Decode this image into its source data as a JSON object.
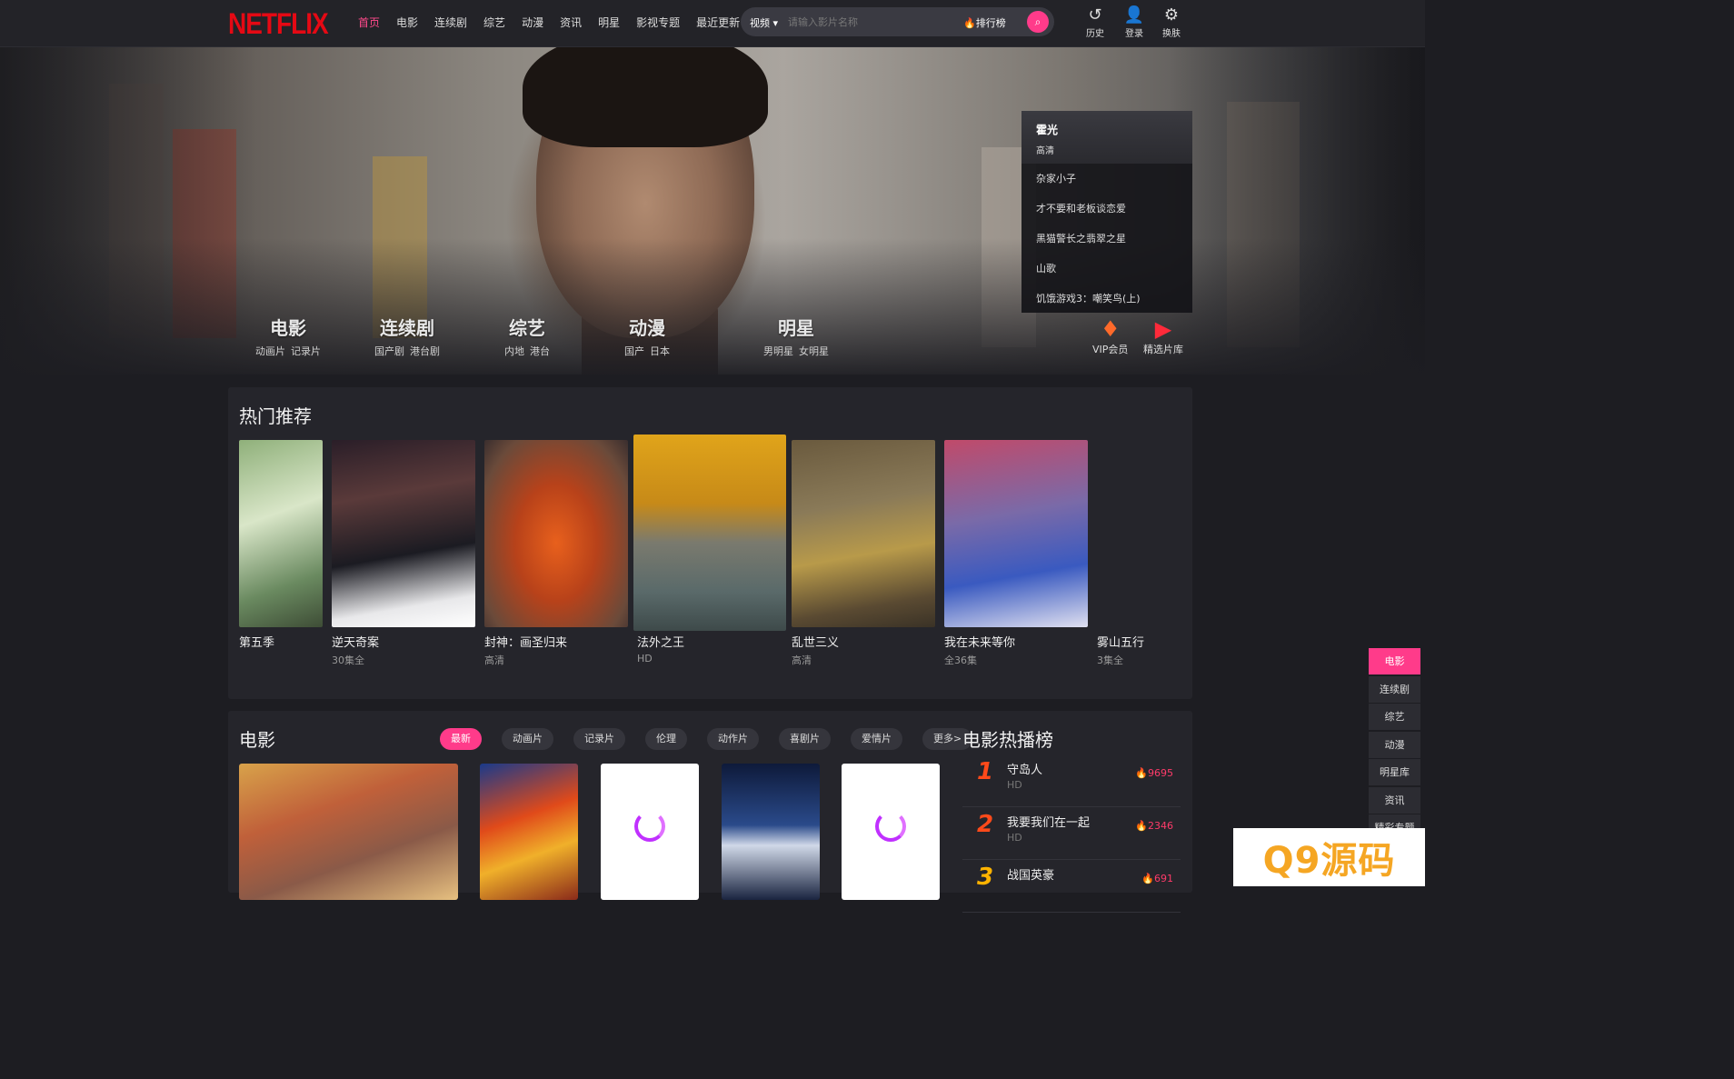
{
  "header": {
    "logo": "NETFLIX",
    "nav": [
      "首页",
      "电影",
      "连续剧",
      "综艺",
      "动漫",
      "资讯",
      "明星",
      "影视专题",
      "最近更新"
    ],
    "active_nav": "首页",
    "search": {
      "category": "视频 ▾",
      "placeholder": "请输入影片名称",
      "rank_label": "排行榜"
    },
    "icons": [
      {
        "label": "历史",
        "icon": "history-icon"
      },
      {
        "label": "登录",
        "icon": "user-icon"
      },
      {
        "label": "换肤",
        "icon": "gear-icon"
      }
    ]
  },
  "banner": {
    "categories": [
      {
        "title": "电影",
        "subs": [
          "动画片",
          "记录片"
        ]
      },
      {
        "title": "连续剧",
        "subs": [
          "国产剧",
          "港台剧"
        ]
      },
      {
        "title": "综艺",
        "subs": [
          "内地",
          "港台"
        ]
      },
      {
        "title": "动漫",
        "subs": [
          "国产",
          "日本"
        ]
      },
      {
        "title": "明星",
        "subs": [
          "男明星",
          "女明星"
        ]
      }
    ],
    "side_list": {
      "current_title": "霍光",
      "current_quality": "高清",
      "items": [
        "杂家小子",
        "才不要和老板谈恋爱",
        "黑猫警长之翡翠之星",
        "山歌",
        "饥饿游戏3：嘲笑鸟(上)"
      ]
    },
    "buttons": [
      {
        "label": "VIP会员",
        "icon": "diamond-icon"
      },
      {
        "label": "精选片库",
        "icon": "play-icon"
      }
    ]
  },
  "hot": {
    "title": "热门推荐",
    "items": [
      {
        "name": "第五季",
        "note": ""
      },
      {
        "name": "逆天奇案",
        "note": "30集全"
      },
      {
        "name": "封神：画圣归来",
        "note": "高清"
      },
      {
        "name": "法外之王",
        "note": "HD"
      },
      {
        "name": "乱世三义",
        "note": "高清"
      },
      {
        "name": "我在未来等你",
        "note": "全36集"
      },
      {
        "name": "雾山五行",
        "note": "3集全"
      }
    ]
  },
  "movie": {
    "title": "电影",
    "tags": [
      "最新",
      "动画片",
      "记录片",
      "伦理",
      "动作片",
      "喜剧片",
      "爱情片",
      "更多>"
    ],
    "active_tag": "最新",
    "rank": {
      "title": "电影热播榜",
      "items": [
        {
          "num": "1",
          "name": "守岛人",
          "quality": "HD",
          "hot": "9695"
        },
        {
          "num": "2",
          "name": "我要我们在一起",
          "quality": "HD",
          "hot": "2346"
        },
        {
          "num": "3",
          "name": "战国英豪",
          "quality": "",
          "hot": "691"
        }
      ]
    }
  },
  "float_menu": [
    "电影",
    "连续剧",
    "综艺",
    "动漫",
    "明星库",
    "资讯",
    "精彩专题"
  ],
  "watermark": "Q9源码",
  "colors": {
    "accent": "#ff3b8a",
    "logo": "#e50914",
    "bg": "#1d1d22",
    "panel": "#25252b"
  }
}
